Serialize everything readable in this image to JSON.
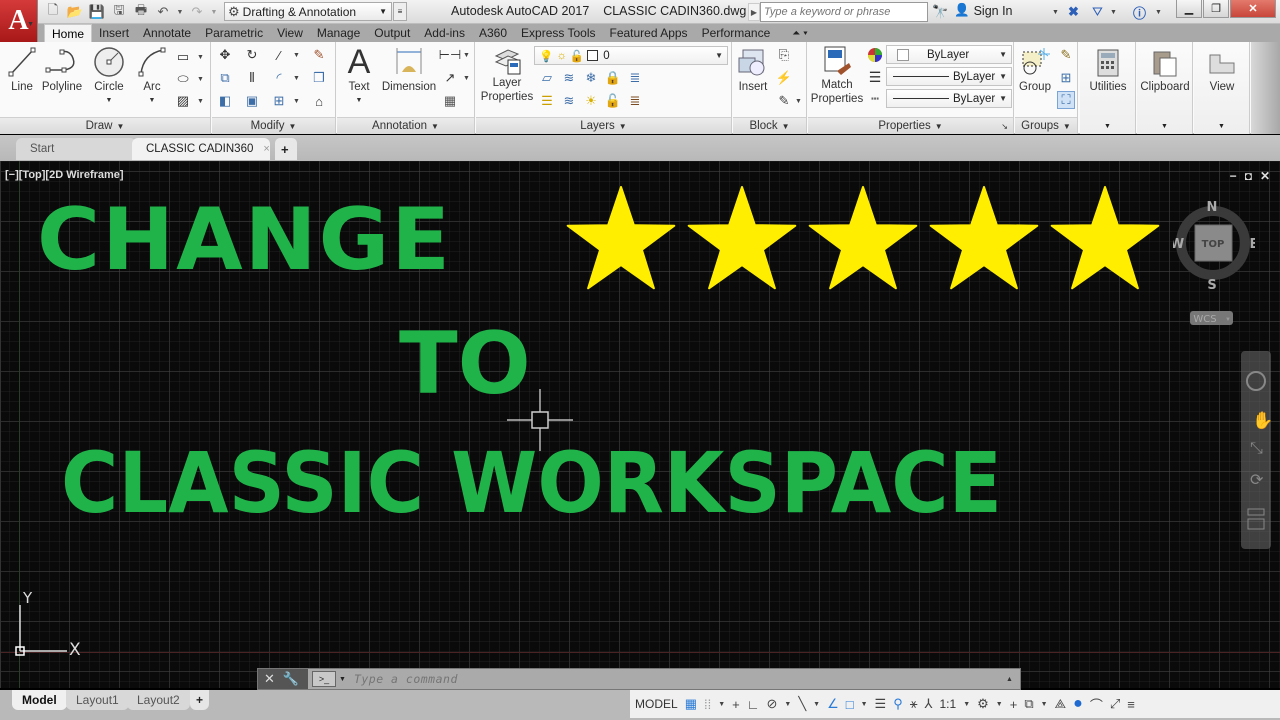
{
  "title_bar": {
    "app_name": "Autodesk AutoCAD 2017",
    "file_name": "CLASSIC CADIN360.dwg",
    "app_logo": "A",
    "quick_access": [
      "new-icon",
      "open-icon",
      "save-icon",
      "save-as-icon",
      "plot-icon",
      "undo-icon",
      "redo-icon"
    ],
    "workspace": "Drafting & Annotation",
    "search_placeholder": "Type a keyword or phrase",
    "sign_in": "Sign In",
    "window_controls": [
      "minimize",
      "restore",
      "close"
    ]
  },
  "ribbon": {
    "tabs": [
      "Home",
      "Insert",
      "Annotate",
      "Parametric",
      "View",
      "Manage",
      "Output",
      "Add-ins",
      "A360",
      "Express Tools",
      "Featured Apps",
      "Performance"
    ],
    "active_tab": "Home",
    "panels": {
      "draw": {
        "label": "Draw",
        "tools": [
          "Line",
          "Polyline",
          "Circle",
          "Arc"
        ]
      },
      "modify": {
        "label": "Modify"
      },
      "annotation": {
        "label": "Annotation",
        "tools": [
          "Text",
          "Dimension"
        ]
      },
      "layers": {
        "label": "Layers",
        "tool": "Layer Properties",
        "tool_line1": "Layer",
        "tool_line2": "Properties",
        "current_layer": "0"
      },
      "block": {
        "label": "Block",
        "tool": "Insert"
      },
      "properties": {
        "label": "Properties",
        "tool_line1": "Match",
        "tool_line2": "Properties",
        "color": "ByLayer",
        "linetype": "ByLayer",
        "lineweight": "ByLayer"
      },
      "groups": {
        "label": "Groups",
        "tool": "Group"
      },
      "utilities": {
        "label": "Utilities"
      },
      "clipboard": {
        "label": "Clipboard"
      },
      "view": {
        "label": "View"
      }
    }
  },
  "doc_tabs": {
    "start": "Start",
    "active": "CLASSIC CADIN360",
    "close": "×",
    "new": "+"
  },
  "viewport": {
    "label": "[−][Top][2D Wireframe]",
    "controls": [
      "−",
      "◘",
      "✕"
    ],
    "text_line1": "CHANGE",
    "text_line2": "TO",
    "text_line3": "CLASSIC WORKSPACE",
    "text_color": "#1fb34a",
    "rating": {
      "stars": 5,
      "max": 5,
      "color": "#ffee00"
    },
    "viewcube": {
      "face": "TOP",
      "n": "N",
      "s": "S",
      "e": "E",
      "w": "W",
      "ucs": "WCS"
    },
    "ucs_x": "X",
    "ucs_y": "Y"
  },
  "command_line": {
    "placeholder": "Type a command"
  },
  "layout_tabs": [
    "Model",
    "Layout1",
    "Layout2",
    "+"
  ],
  "status_bar": {
    "mode": "MODEL",
    "scale": "1:1"
  }
}
